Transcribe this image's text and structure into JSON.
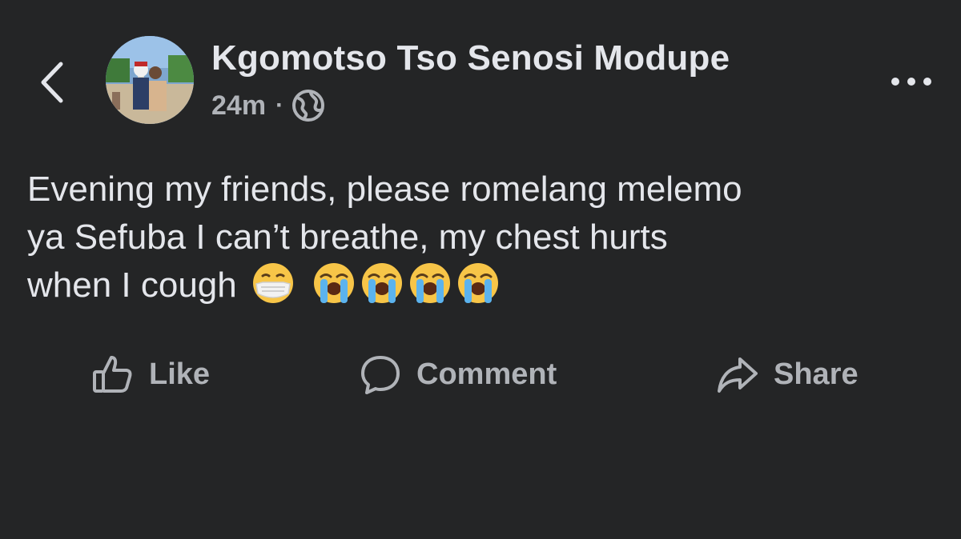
{
  "header": {
    "author_name": "Kgomotso Tso Senosi Modupe",
    "timestamp": "24m",
    "separator": "·",
    "audience_icon": "globe-icon",
    "back_icon": "chevron-left-icon",
    "more_icon": "more-horizontal-icon"
  },
  "post": {
    "line1": "Evening my friends, please romelang melemo",
    "line2": "ya Sefuba I can’t breathe, my chest hurts",
    "line3": "when I cough",
    "emojis": [
      "😷",
      "😭",
      "😭",
      "😭",
      "😭"
    ]
  },
  "actions": {
    "like_label": "Like",
    "comment_label": "Comment",
    "share_label": "Share"
  },
  "colors": {
    "background": "#242526",
    "primary_text": "#e4e6eb",
    "secondary_text": "#b0b3b8"
  }
}
